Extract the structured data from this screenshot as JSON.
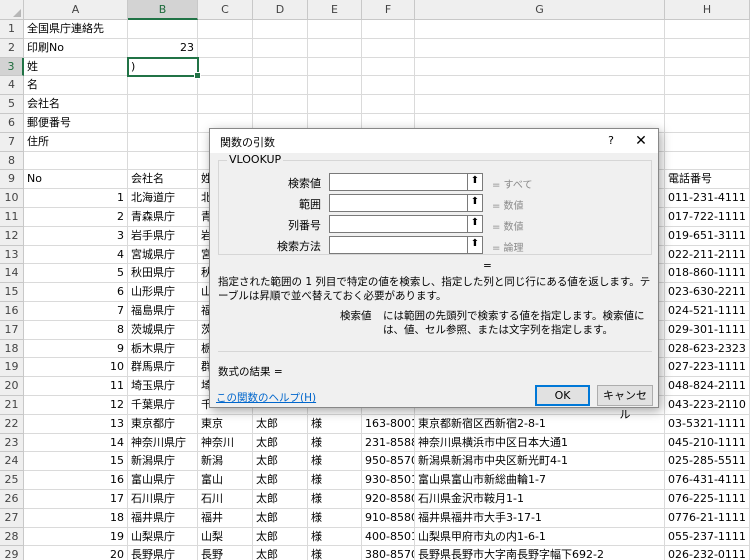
{
  "columns": [
    "A",
    "B",
    "C",
    "D",
    "E",
    "F",
    "G",
    "H"
  ],
  "rows": [
    {
      "n": "1",
      "a": "全国県庁連絡先"
    },
    {
      "n": "2",
      "a": "印刷No",
      "b": "23"
    },
    {
      "n": "3",
      "a": "姓",
      "b": ")"
    },
    {
      "n": "4",
      "a": "名"
    },
    {
      "n": "5",
      "a": "会社名"
    },
    {
      "n": "6",
      "a": "郵便番号"
    },
    {
      "n": "7",
      "a": "住所"
    },
    {
      "n": "8"
    },
    {
      "n": "9",
      "a": "No",
      "b": "会社名",
      "c": "姓",
      "h": "電話番号"
    },
    {
      "n": "10",
      "a": "1",
      "b": "北海道庁",
      "c": "北",
      "h": "011-231-4111"
    },
    {
      "n": "11",
      "a": "2",
      "b": "青森県庁",
      "c": "青",
      "h": "017-722-1111"
    },
    {
      "n": "12",
      "a": "3",
      "b": "岩手県庁",
      "c": "岩",
      "h": "019-651-3111"
    },
    {
      "n": "13",
      "a": "4",
      "b": "宮城県庁",
      "c": "宮",
      "h": "022-211-2111"
    },
    {
      "n": "14",
      "a": "5",
      "b": "秋田県庁",
      "c": "秋",
      "h": "018-860-1111"
    },
    {
      "n": "15",
      "a": "6",
      "b": "山形県庁",
      "c": "山",
      "h": "023-630-2211"
    },
    {
      "n": "16",
      "a": "7",
      "b": "福島県庁",
      "c": "福",
      "h": "024-521-1111"
    },
    {
      "n": "17",
      "a": "8",
      "b": "茨城県庁",
      "c": "茨",
      "h": "029-301-1111"
    },
    {
      "n": "18",
      "a": "9",
      "b": "栃木県庁",
      "c": "栃",
      "h": "028-623-2323"
    },
    {
      "n": "19",
      "a": "10",
      "b": "群馬県庁",
      "c": "群",
      "h": "027-223-1111"
    },
    {
      "n": "20",
      "a": "11",
      "b": "埼玉県庁",
      "c": "埼",
      "h": "048-824-2111"
    },
    {
      "n": "21",
      "a": "12",
      "b": "千葉県庁",
      "c": "千",
      "h": "043-223-2110"
    },
    {
      "n": "22",
      "a": "13",
      "b": "東京都庁",
      "c": "東京",
      "d": "太郎",
      "e": "様",
      "f": "163-8001",
      "g": "東京都新宿区西新宿2-8-1",
      "h": "03-5321-1111"
    },
    {
      "n": "23",
      "a": "14",
      "b": "神奈川県庁",
      "c": "神奈川",
      "d": "太郎",
      "e": "様",
      "f": "231-8588",
      "g": "神奈川県横浜市中区日本大通1",
      "h": "045-210-1111"
    },
    {
      "n": "24",
      "a": "15",
      "b": "新潟県庁",
      "c": "新潟",
      "d": "太郎",
      "e": "様",
      "f": "950-8570",
      "g": "新潟県新潟市中央区新光町4-1",
      "h": "025-285-5511"
    },
    {
      "n": "25",
      "a": "16",
      "b": "富山県庁",
      "c": "富山",
      "d": "太郎",
      "e": "様",
      "f": "930-8501",
      "g": "富山県富山市新総曲輪1-7",
      "h": "076-431-4111"
    },
    {
      "n": "26",
      "a": "17",
      "b": "石川県庁",
      "c": "石川",
      "d": "太郎",
      "e": "様",
      "f": "920-8580",
      "g": "石川県金沢市鞍月1-1",
      "h": "076-225-1111"
    },
    {
      "n": "27",
      "a": "18",
      "b": "福井県庁",
      "c": "福井",
      "d": "太郎",
      "e": "様",
      "f": "910-8580",
      "g": "福井県福井市大手3-17-1",
      "h": "0776-21-1111"
    },
    {
      "n": "28",
      "a": "19",
      "b": "山梨県庁",
      "c": "山梨",
      "d": "太郎",
      "e": "様",
      "f": "400-8501",
      "g": "山梨県甲府市丸の内1-6-1",
      "h": "055-237-1111"
    },
    {
      "n": "29",
      "a": "20",
      "b": "長野県庁",
      "c": "長野",
      "d": "太郎",
      "e": "様",
      "f": "380-8570",
      "g": "長野県長野市大字南長野字幅下692-2",
      "h": "026-232-0111"
    }
  ],
  "active_cell": "B3",
  "dialog": {
    "title": "関数の引数",
    "help_glyph": "?",
    "close_glyph": "✕",
    "function_name": "VLOOKUP",
    "args": [
      {
        "label": "検索値",
        "value": "",
        "result": "= すべて"
      },
      {
        "label": "範囲",
        "value": "",
        "result": "= 数値"
      },
      {
        "label": "列番号",
        "value": "",
        "result": "= 数値"
      },
      {
        "label": "検索方法",
        "value": "",
        "result": "= 論理"
      }
    ],
    "range_btn_glyph": "⬆",
    "equals_line": "=",
    "description": "指定された範囲の 1 列目で特定の値を検索し、指定した列と同じ行にある値を返します。テーブルは昇順で並べ替えておく必要があります。",
    "arg_name": "検索値",
    "arg_description": "には範囲の先頭列で検索する値を指定します。検索値には、値、セル参照、または文字列を指定します。",
    "formula_result_label": "数式の結果 =",
    "help_link": "この関数のヘルプ(H)",
    "ok_label": "OK",
    "cancel_label": "キャンセル"
  }
}
